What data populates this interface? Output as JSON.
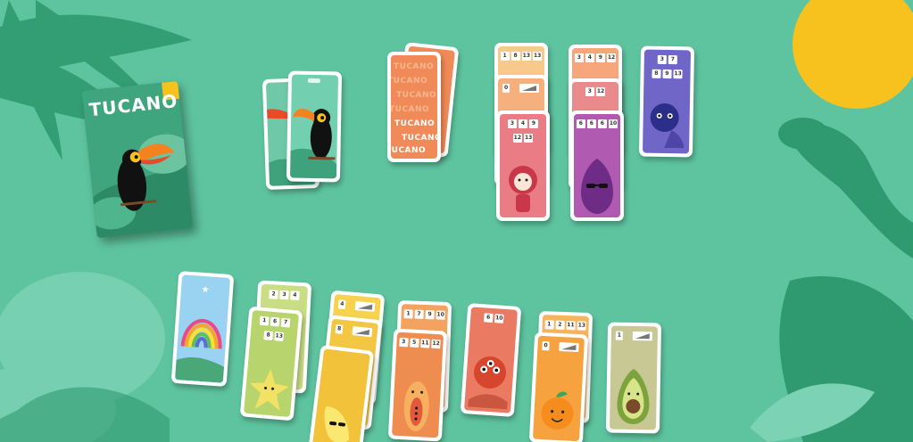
{
  "game": {
    "title": "TUCANO",
    "back_text": [
      "TUCANO",
      "TUCANO",
      "TUCANO",
      "TUCANO",
      "TUCANO",
      "TUCANO",
      "TUCANO"
    ]
  },
  "colors": {
    "table": "#5ec4a0",
    "sun": "#f7c21e",
    "leaf_dark": "#2f9a70",
    "leaf_light": "#7bd2b4",
    "card_back": "#f08a58"
  },
  "top_cards": {
    "pink": {
      "row1": [
        "3",
        "4",
        "9"
      ],
      "row2": [
        "12",
        "13"
      ]
    },
    "purple": {
      "row1": [
        "6",
        "6",
        "6",
        "10"
      ]
    },
    "blue": {
      "row1": [
        "3",
        "7"
      ],
      "row2": [
        "8",
        "9",
        "13"
      ]
    },
    "yellow_top": {
      "row1": [
        "1",
        "8",
        "13",
        "13"
      ]
    },
    "orange_top": {
      "row1": [
        "3",
        "4",
        "9",
        "12"
      ]
    },
    "salmon_mid": {
      "row1": [
        "3",
        "12"
      ]
    }
  },
  "bottom_cards": {
    "lime_a": {
      "row1": [
        "2",
        "3",
        "4"
      ]
    },
    "lime_b": {
      "row1": [
        "1",
        "6",
        "7"
      ],
      "row2": [
        "8",
        "13"
      ]
    },
    "yellow_a": {
      "ramp_label": "4"
    },
    "yellow_b": {
      "ramp_label": "8"
    },
    "papaya_a": {
      "row1": [
        "1",
        "7",
        "9",
        "10"
      ]
    },
    "papaya_b": {
      "row1": [
        "3",
        "5",
        "11",
        "12"
      ]
    },
    "lychee": {
      "row1": [
        "6",
        "10"
      ]
    },
    "orange_a": {
      "row1": [
        "1",
        "2",
        "11",
        "13"
      ]
    },
    "avocado": {
      "ramp_label": "1"
    }
  }
}
